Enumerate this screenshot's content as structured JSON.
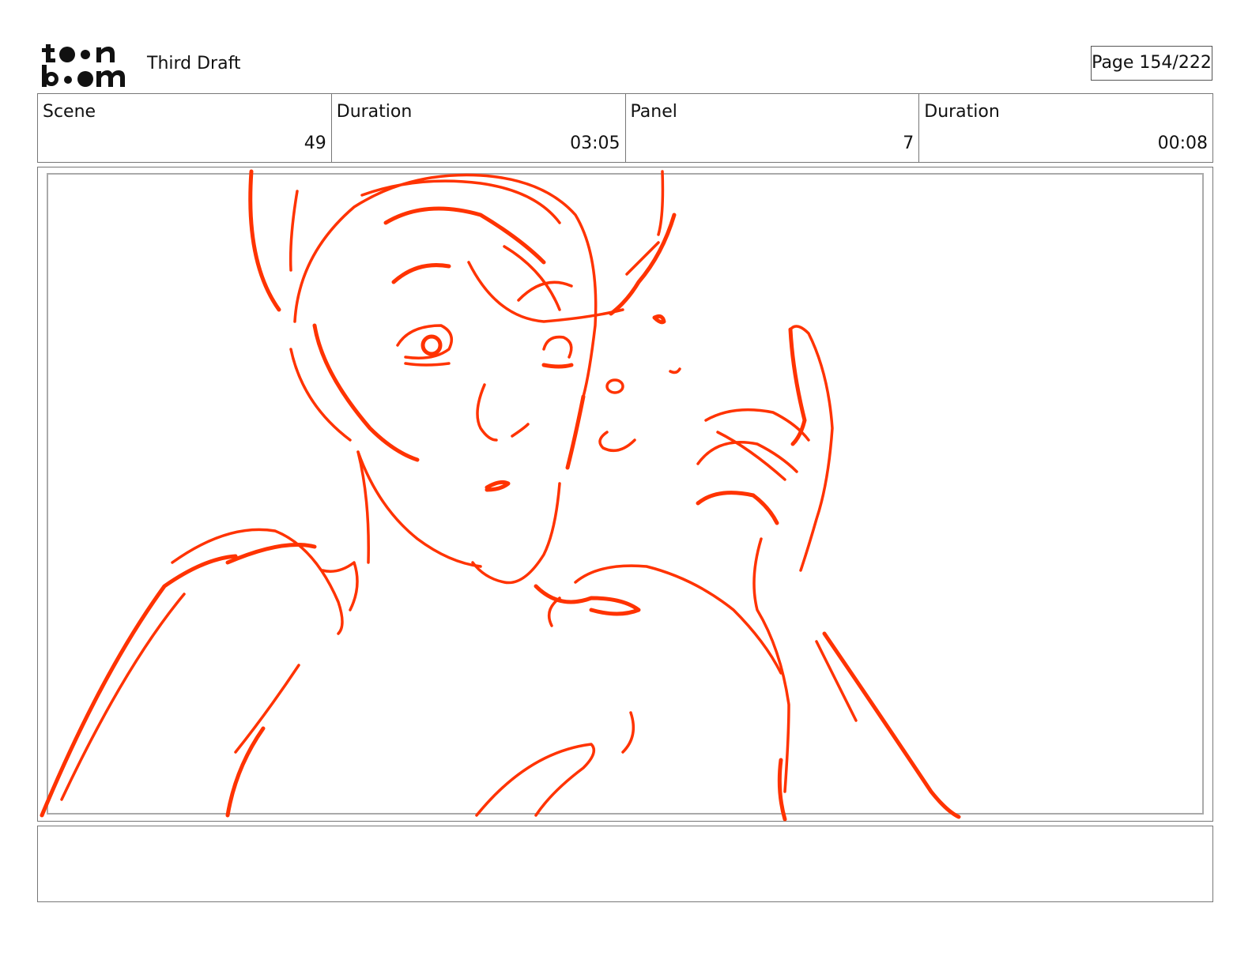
{
  "header": {
    "logo_text": "toon boom",
    "document_title": "Third Draft",
    "page_label": "Page 154/222"
  },
  "info": {
    "scene_label": "Scene",
    "scene_value": "49",
    "scene_duration_label": "Duration",
    "scene_duration_value": "03:05",
    "panel_label": "Panel",
    "panel_value": "7",
    "panel_duration_label": "Duration",
    "panel_duration_value": "00:08"
  },
  "panel": {
    "sketch_color": "#ff3300"
  },
  "notes": {
    "text": ""
  }
}
